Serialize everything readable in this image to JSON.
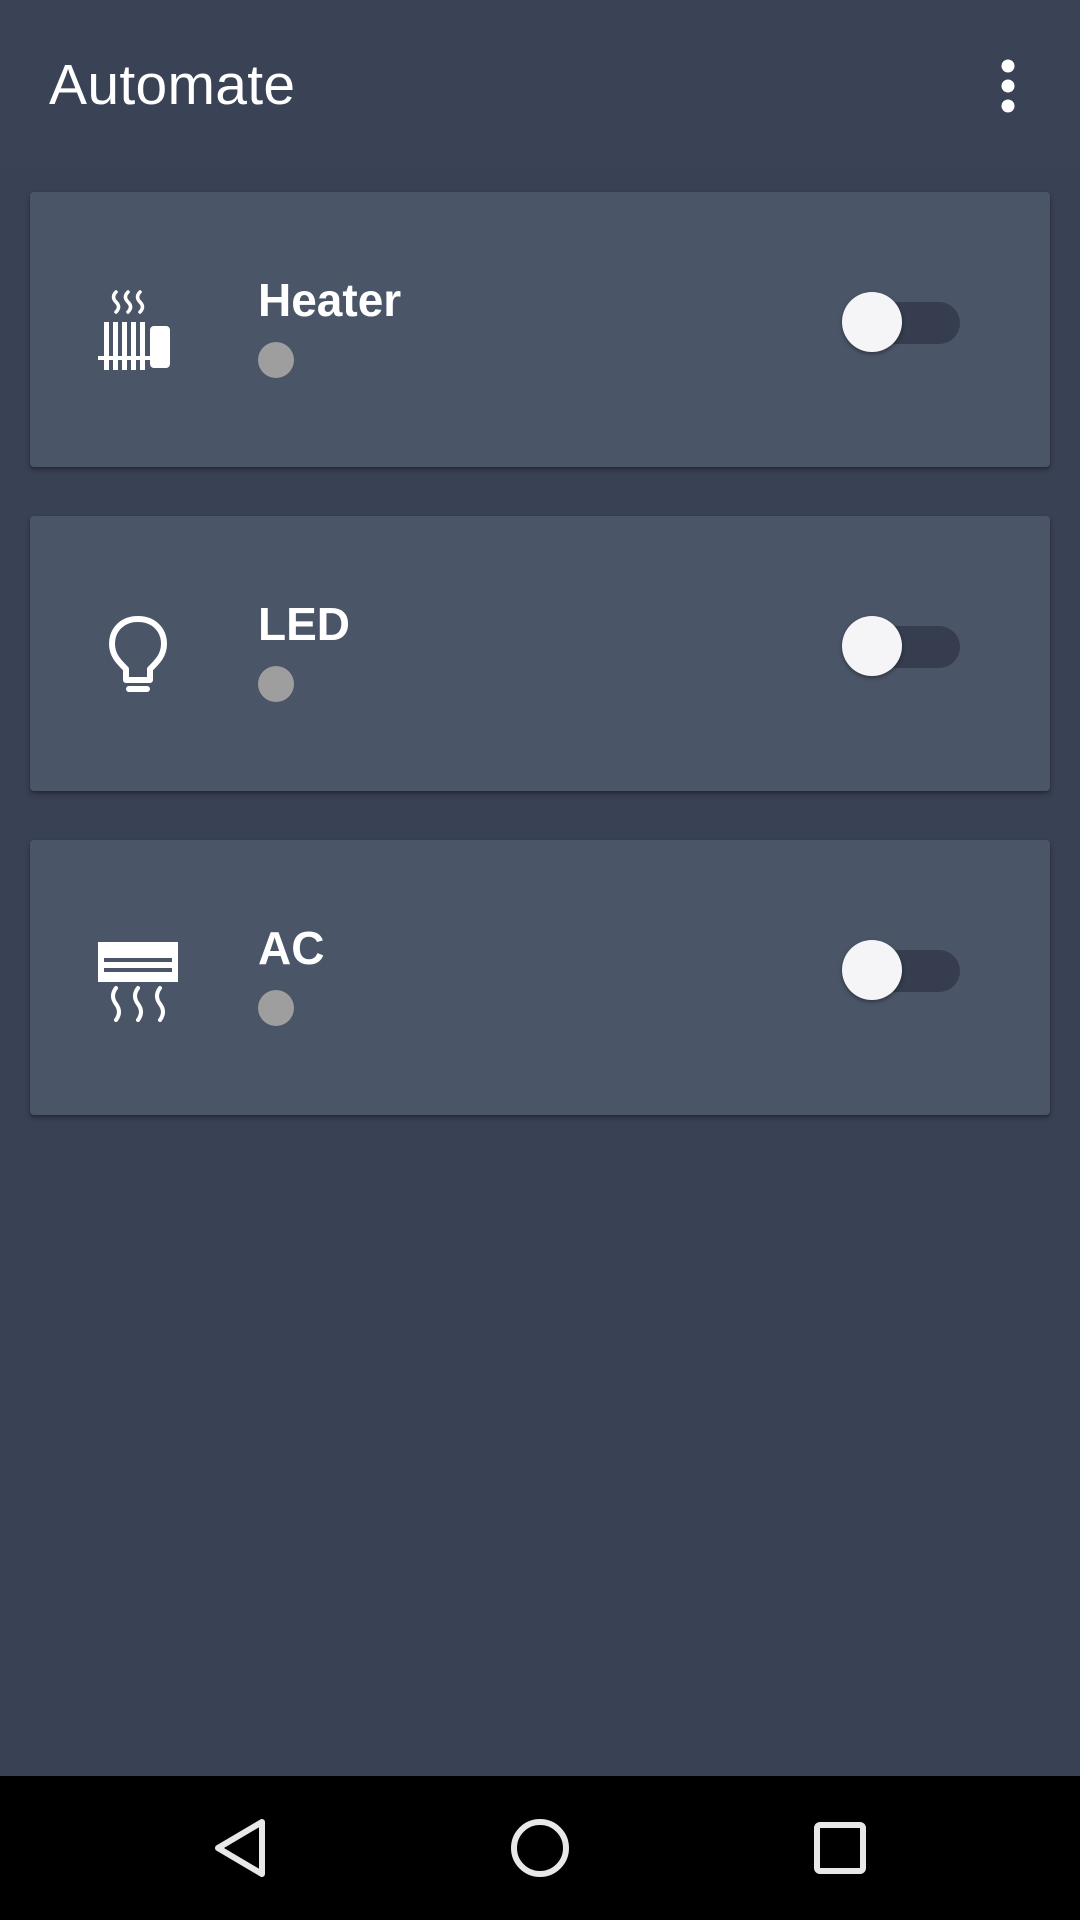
{
  "app": {
    "title": "Automate"
  },
  "header": {
    "overflow_icon": "more-vert-icon"
  },
  "devices": [
    {
      "name": "Heater",
      "icon": "radiator-icon",
      "enabled": false,
      "status_color": "#9e9e9e"
    },
    {
      "name": "LED",
      "icon": "lightbulb-icon",
      "enabled": false,
      "status_color": "#9e9e9e"
    },
    {
      "name": "AC",
      "icon": "air-conditioner-icon",
      "enabled": false,
      "status_color": "#9e9e9e"
    }
  ],
  "navigation": {
    "back_icon": "back-triangle-icon",
    "home_icon": "home-circle-icon",
    "recents_icon": "recents-square-icon"
  },
  "colors": {
    "background": "#394154",
    "card": "#4b5568",
    "toggle_track": "#353d4e",
    "toggle_thumb": "#f5f5f7",
    "status_off": "#9e9e9e",
    "nav_bar": "#000000"
  }
}
